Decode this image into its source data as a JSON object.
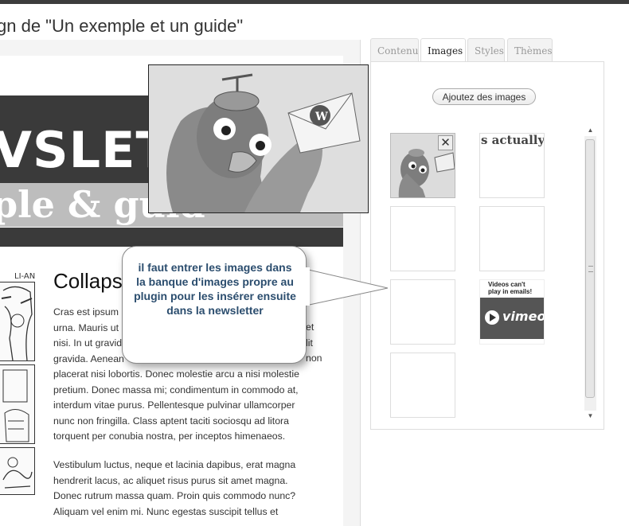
{
  "page": {
    "title": "gn de \"Un exemple et un guide\""
  },
  "newsletter": {
    "banner_title": "VSLETT",
    "banner_subtitle": "ple & guid",
    "comic_tag": "LI-AN",
    "article_title": "Collaps",
    "paragraph1": "Cras est ipsum urna. Mauris ut nisi. In ut gravid gravida. Aenean placerat nisi lobortis. Donec molestie arcu a nisi molestie pretium. Donec massa mi; condimentum in commodo at, interdum vitae purus. Pellentesque pulvinar ullamcorper nunc non fringilla. Class aptent taciti sociosqu ad litora torquent per conubia nostra, per inceptos himenaeos.",
    "paragraph1_lines": [
      "Cras est ipsum",
      "urna. Mauris ut",
      "nisi. In ut gravid",
      "gravida. Aenean",
      "placerat nisi lobortis. Donec molestie arcu a nisi molestie",
      "pretium. Donec massa mi; condimentum in commodo at,",
      "interdum vitae purus. Pellentesque pulvinar ullamcorper",
      "nunc non fringilla. Class aptent taciti sociosqu ad litora",
      "torquent per conubia nostra, per inceptos himenaeos."
    ],
    "paragraph1_right_fragments": [
      "et",
      "lit",
      "non"
    ],
    "paragraph2_lines": [
      "Vestibulum luctus, neque et lacinia dapibus, erat magna",
      "hendrerit lacus, ac aliquet risus purus sit amet magna.",
      "Donec rutrum massa quam. Proin quis commodo nunc?",
      "Aliquam vel enim mi. Nunc egestas suscipit tellus et"
    ]
  },
  "tabs": [
    {
      "label": "Contenu",
      "active": false
    },
    {
      "label": "Images",
      "active": true
    },
    {
      "label": "Styles",
      "active": false
    },
    {
      "label": "Thèmes",
      "active": false
    }
  ],
  "images_panel": {
    "add_button": "Ajoutez des images",
    "thumb_actually_text": "s actually",
    "vimeo_caption_line1": "Videos can't",
    "vimeo_caption_line2": "play in emails!",
    "vimeo_logo": "vimeo",
    "close_glyph": "✕"
  },
  "callout": {
    "text": "il faut entrer les images dans la banque d'images propre au plugin pour les insérer ensuite dans la newsletter"
  },
  "scrollbar": {
    "up_glyph": "▲",
    "down_glyph": "▼"
  },
  "colors": {
    "banner_dark": "#3a3a3a",
    "banner_light": "#bdbdbd",
    "callout_text": "#2b4d6e"
  }
}
